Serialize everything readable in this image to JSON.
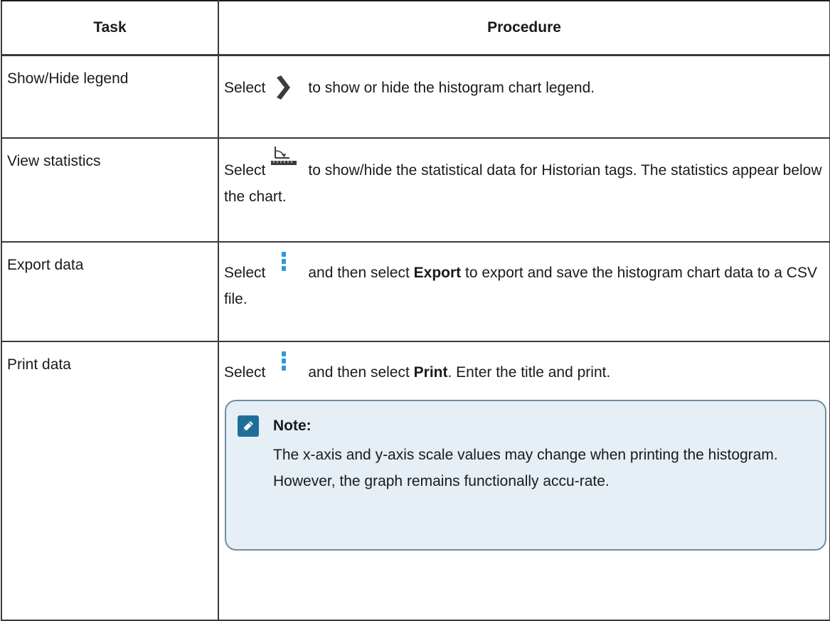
{
  "table": {
    "headers": {
      "task": "Task",
      "procedure": "Procedure"
    },
    "rows": [
      {
        "task": "Show/Hide legend",
        "select": "Select",
        "icon": "chevron-right-icon",
        "rest": "to show or hide the histogram chart legend."
      },
      {
        "task": "View statistics",
        "select": "Select",
        "icon": "statistics-icon",
        "rest": "to show/hide the statistical data for Historian tags. The statistics appear below the chart."
      },
      {
        "task": "Export data",
        "select": "Select",
        "icon": "more-options-icon",
        "rest_before": "and then select",
        "bold": "Export",
        "rest_after": "to export and save the histogram chart data to a CSV file."
      },
      {
        "task": "Print data",
        "select": "Select",
        "icon": "more-options-icon",
        "rest_before": "and then select",
        "bold": "Print",
        "rest_after": ". Enter the title and print."
      }
    ]
  },
  "note": {
    "title": "Note:",
    "icon": "pencil-icon",
    "text": "The x-axis and y-axis scale values may change when printing the histogram. However, the graph remains functionally accu-rate."
  },
  "colors": {
    "icon_blue": "#2f9ad6",
    "note_bg": "#e6eff5",
    "note_border": "#6f8ea3",
    "note_icon_bg": "#1f6e99",
    "chevron": "#3c3c3c"
  }
}
